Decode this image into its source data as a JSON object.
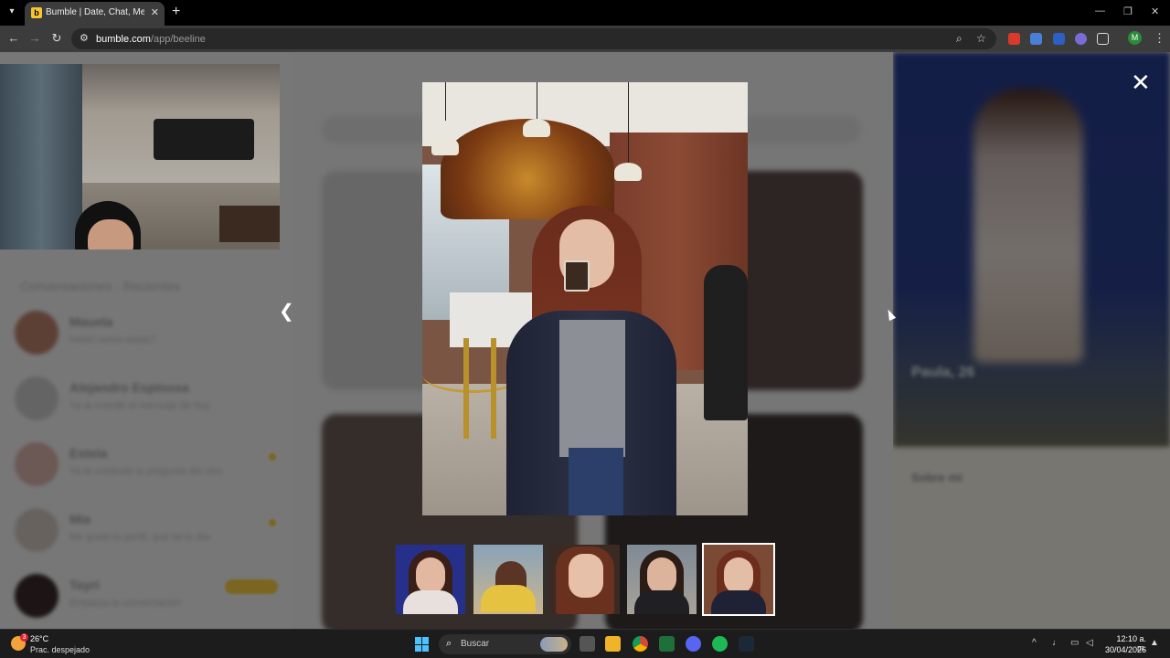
{
  "browser": {
    "tab_title": "Bumble | Date, Chat, Meet New",
    "url_host": "bumble.com",
    "url_path": "/app/beeline",
    "profile_initial": "M"
  },
  "sidebar": {
    "section_title": "Conversaciones · Recientes",
    "conversations": [
      {
        "name": "Mauela",
        "preview": "Hola!! como estas?"
      },
      {
        "name": "Alejandro Espinosa",
        "preview": "Ya te mandé el mensaje de hoy"
      },
      {
        "name": "Estela",
        "preview": "Ya te contesté la pregunta del otro"
      },
      {
        "name": "Mia",
        "preview": "Me gustó tu perfil, qué tal tu día"
      },
      {
        "name": "Tayri",
        "preview": "Empieza la conversación"
      }
    ]
  },
  "right_panel": {
    "name_age": "Paula, 26",
    "section": "Sobre mí"
  },
  "taskbar": {
    "weather_temp": "26°C",
    "weather_desc": "Prac. despejado",
    "weather_badge": "3",
    "search_label": "Buscar",
    "time": "12:10 a. m.",
    "date": "30/04/2026"
  },
  "colors": {
    "bumble_yellow": "#f4cc42",
    "windows_accent": "#4cc2ff"
  }
}
